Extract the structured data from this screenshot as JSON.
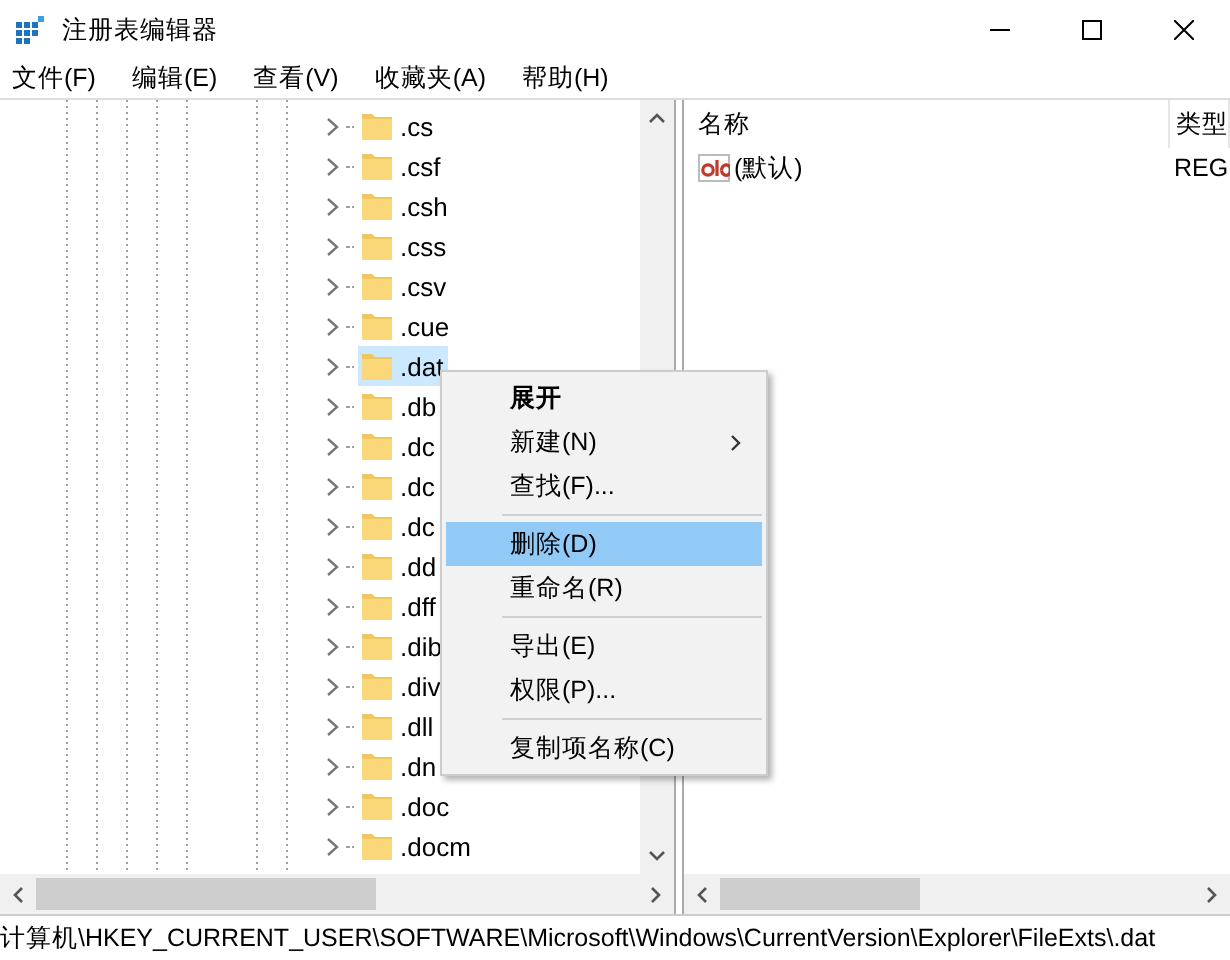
{
  "window": {
    "title": "注册表编辑器"
  },
  "menu_bar": [
    "文件(F)",
    "编辑(E)",
    "查看(V)",
    "收藏夹(A)",
    "帮助(H)"
  ],
  "tree": {
    "items": [
      {
        "label": ".cs",
        "selected": false
      },
      {
        "label": ".csf",
        "selected": false
      },
      {
        "label": ".csh",
        "selected": false
      },
      {
        "label": ".css",
        "selected": false
      },
      {
        "label": ".csv",
        "selected": false
      },
      {
        "label": ".cue",
        "selected": false
      },
      {
        "label": ".dat",
        "selected": true
      },
      {
        "label": ".db",
        "selected": false
      },
      {
        "label": ".dc",
        "selected": false
      },
      {
        "label": ".dc",
        "selected": false
      },
      {
        "label": ".dc",
        "selected": false
      },
      {
        "label": ".dd",
        "selected": false
      },
      {
        "label": ".dff",
        "selected": false
      },
      {
        "label": ".dib",
        "selected": false
      },
      {
        "label": ".div",
        "selected": false
      },
      {
        "label": ".dll",
        "selected": false
      },
      {
        "label": ".dn",
        "selected": false
      },
      {
        "label": ".doc",
        "selected": false
      },
      {
        "label": ".docm",
        "selected": false
      }
    ]
  },
  "values": {
    "columns": [
      "名称",
      "类型"
    ],
    "rows": [
      {
        "name": "(默认)",
        "type": "REG"
      }
    ]
  },
  "context_menu": [
    {
      "kind": "item",
      "label": "展开",
      "default": true,
      "submenu": false,
      "selected": false
    },
    {
      "kind": "item",
      "label": "新建(N)",
      "default": false,
      "submenu": true,
      "selected": false
    },
    {
      "kind": "item",
      "label": "查找(F)...",
      "default": false,
      "submenu": false,
      "selected": false
    },
    {
      "kind": "separator"
    },
    {
      "kind": "item",
      "label": "删除(D)",
      "default": false,
      "submenu": false,
      "selected": true
    },
    {
      "kind": "item",
      "label": "重命名(R)",
      "default": false,
      "submenu": false,
      "selected": false
    },
    {
      "kind": "separator"
    },
    {
      "kind": "item",
      "label": "导出(E)",
      "default": false,
      "submenu": false,
      "selected": false
    },
    {
      "kind": "item",
      "label": "权限(P)...",
      "default": false,
      "submenu": false,
      "selected": false
    },
    {
      "kind": "separator"
    },
    {
      "kind": "item",
      "label": "复制项名称(C)",
      "default": false,
      "submenu": false,
      "selected": false
    }
  ],
  "status_bar": "计算机\\HKEY_CURRENT_USER\\SOFTWARE\\Microsoft\\Windows\\CurrentVersion\\Explorer\\FileExts\\.dat"
}
